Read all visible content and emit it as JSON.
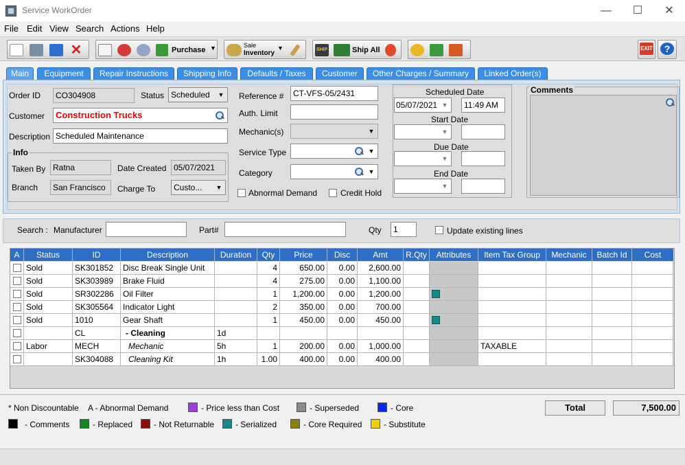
{
  "window": {
    "title": "Service WorkOrder",
    "minimize": "—",
    "maximize": "☐",
    "close": "✕"
  },
  "menu": [
    "File",
    "Edit",
    "View",
    "Search",
    "Actions",
    "Help"
  ],
  "toolbar": {
    "purchase": "Purchase",
    "sale_inventory_1": "Sale",
    "sale_inventory_2": "Inventory",
    "ship_all": "Ship All",
    "ship_small": "SHIP",
    "exit": "EXIT",
    "help": "?"
  },
  "tabs": [
    "Main",
    "Equipment",
    "Repair Instructions",
    "Shipping Info",
    "Defaults / Taxes",
    "Customer",
    "Other Charges / Summary",
    "Linked Order(s)"
  ],
  "form": {
    "order_id_label": "Order ID",
    "order_id": "CO304908",
    "status_label": "Status",
    "status": "Scheduled",
    "customer_label": "Customer",
    "customer": "Construction Trucks",
    "description_label": "Description",
    "description": "Scheduled Maintenance",
    "info_title": "Info",
    "taken_by_label": "Taken By",
    "taken_by": "Ratna",
    "date_created_label": "Date Created",
    "date_created": "05/07/2021",
    "branch_label": "Branch",
    "branch": "San Francisco",
    "charge_to_label": "Charge To",
    "charge_to": "Custo...",
    "reference_label": "Reference #",
    "reference": "CT-VFS-05/2431",
    "auth_limit_label": "Auth. Limit",
    "auth_limit": "",
    "mechanics_label": "Mechanic(s)",
    "mechanics": "",
    "service_type_label": "Service Type",
    "service_type": "",
    "category_label": "Category",
    "category": "",
    "abnormal_demand": "Abnormal Demand",
    "credit_hold": "Credit Hold",
    "scheduled_date_label": "Scheduled Date",
    "scheduled_date": "05/07/2021",
    "scheduled_time": "11:49 AM",
    "start_date_label": "Start Date",
    "due_date_label": "Due Date",
    "end_date_label": "End Date",
    "comments_label": "Comments"
  },
  "search": {
    "label": "Search :",
    "manufacturer_label": "Manufacturer",
    "part_label": "Part#",
    "qty_label": "Qty",
    "qty": "1",
    "update_lines": "Update existing lines"
  },
  "grid": {
    "headers": [
      "A",
      "Status",
      "ID",
      "Description",
      "Duration",
      "Qty",
      "Price",
      "Disc",
      "Amt",
      "R.Qty",
      "Attributes",
      "Item Tax Group",
      "Mechanic",
      "Batch Id",
      "Cost"
    ],
    "rows": [
      {
        "status": "Sold",
        "id": "SK301852",
        "desc": "Disc Break Single Unit",
        "duration": "",
        "qty": "4",
        "price": "650.00",
        "disc": "0.00",
        "amt": "2,600.00",
        "tax": "",
        "attr": ""
      },
      {
        "status": "Sold",
        "id": "SK303989",
        "desc": "Brake Fluid",
        "duration": "",
        "qty": "4",
        "price": "275.00",
        "disc": "0.00",
        "amt": "1,100.00",
        "tax": "",
        "attr": ""
      },
      {
        "status": "Sold",
        "id": "SR302286",
        "desc": "Oil Filter",
        "duration": "",
        "qty": "1",
        "price": "1,200.00",
        "disc": "0.00",
        "amt": "1,200.00",
        "tax": "",
        "attr": "#138a8a"
      },
      {
        "status": "Sold",
        "id": "SK305564",
        "desc": "Indicator Light",
        "duration": "",
        "qty": "2",
        "price": "350.00",
        "disc": "0.00",
        "amt": "700.00",
        "tax": "",
        "attr": ""
      },
      {
        "status": "Sold",
        "id": "1010",
        "desc": "Gear Shaft",
        "duration": "",
        "qty": "1",
        "price": "450.00",
        "disc": "0.00",
        "amt": "450.00",
        "tax": "",
        "attr": "#138a8a"
      },
      {
        "status": "",
        "id": "CL",
        "desc": "-  Cleaning",
        "duration": "1d",
        "qty": "",
        "price": "",
        "disc": "",
        "amt": "",
        "tax": "",
        "attr": "",
        "bold": true
      },
      {
        "status": "Labor",
        "id": "MECH",
        "desc": "Mechanic",
        "duration": "5h",
        "qty": "1",
        "price": "200.00",
        "disc": "0.00",
        "amt": "1,000.00",
        "tax": "TAXABLE",
        "attr": "",
        "italic": true
      },
      {
        "status": "",
        "id": "SK304088",
        "desc": "Cleaning Kit",
        "duration": "1h",
        "qty": "1.00",
        "price": "400.00",
        "disc": "0.00",
        "amt": "400.00",
        "tax": "",
        "attr": "",
        "italic": true
      }
    ]
  },
  "legend": {
    "non_discountable": "* Non Discountable",
    "abnormal": "A - Abnormal Demand",
    "items": [
      {
        "label": "- Price less than Cost",
        "color": "#9b3fdc"
      },
      {
        "label": "- Superseded",
        "color": "#8a8a8a"
      },
      {
        "label": "- Core",
        "color": "#0a2be6"
      },
      {
        "label": "- Comments",
        "color": "#000000"
      },
      {
        "label": "- Replaced",
        "color": "#0c8a1e"
      },
      {
        "label": "- Not Returnable",
        "color": "#8a0c0c"
      },
      {
        "label": "- Serialized",
        "color": "#138a8a"
      },
      {
        "label": "- Core Required",
        "color": "#86800c"
      },
      {
        "label": "- Substitute",
        "color": "#f2cf0d"
      }
    ]
  },
  "totals": {
    "label": "Total",
    "value": "7,500.00"
  }
}
